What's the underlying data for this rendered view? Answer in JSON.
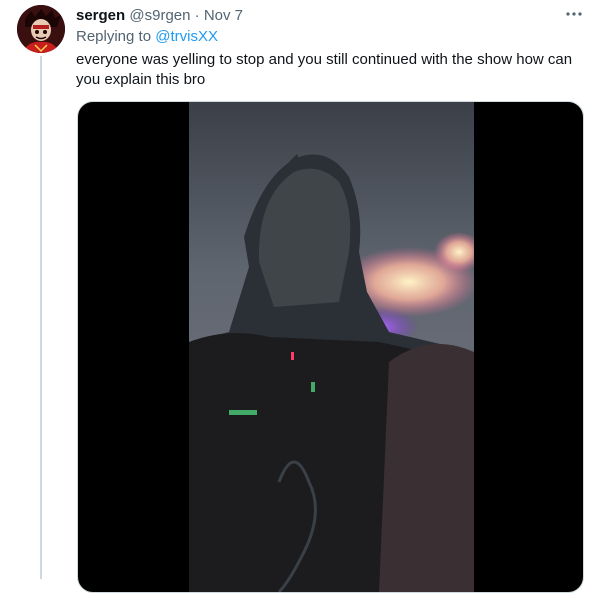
{
  "tweet": {
    "display_name": "sergen",
    "handle": "@s9rgen",
    "separator": "·",
    "time": "Nov 7",
    "replying_label": "Replying to",
    "replying_to": "@trvisXX",
    "text": "everyone was yelling to stop and you still continued with the show how can you explain this bro"
  },
  "icons": {
    "more": "more-horizontal-icon"
  },
  "colors": {
    "accent": "#1d9bf0",
    "secondary_text": "#536471",
    "primary_text": "#0f1419",
    "thread_line": "#cfd9de",
    "media_bg": "#000000"
  }
}
